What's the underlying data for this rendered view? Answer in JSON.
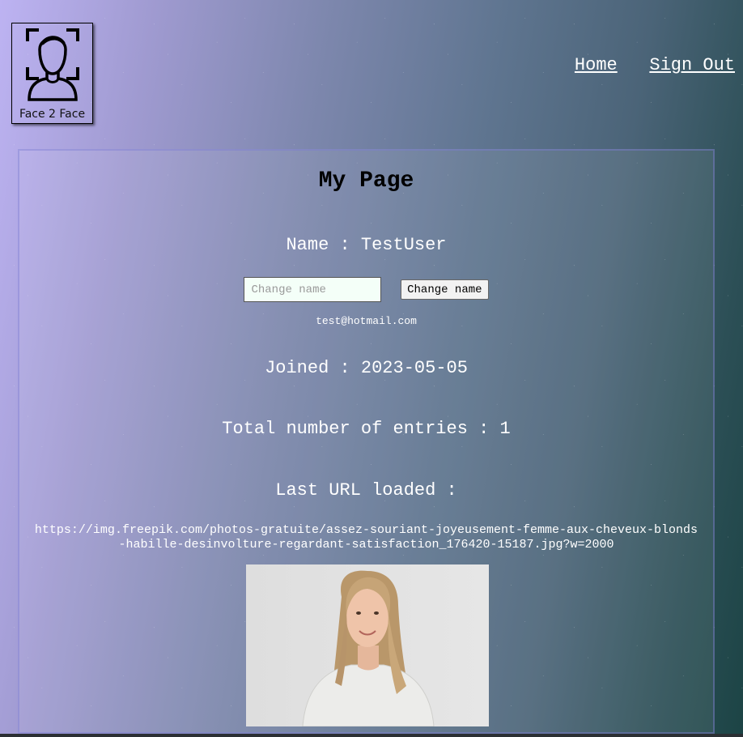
{
  "header": {
    "logo": {
      "text": "Face 2 Face",
      "icon": "face-scan-icon"
    },
    "nav": {
      "home": "Home",
      "sign_out": "Sign Out"
    }
  },
  "profile": {
    "title": "My Page",
    "name_line": "Name : TestUser",
    "change_name_placeholder": "Change name",
    "change_name_button": "Change name",
    "email": "test@hotmail.com",
    "joined_line": "Joined : 2023-05-05",
    "entries_line": "Total number of entries : 1",
    "last_url_label": "Last URL loaded :",
    "last_url": "https://img.freepik.com/photos-gratuite/assez-souriant-joyeusement-femme-aux-cheveux-blonds-habille-desinvolture-regardant-satisfaction_176420-15187.jpg?w=2000",
    "photo": "portrait-photo"
  }
}
